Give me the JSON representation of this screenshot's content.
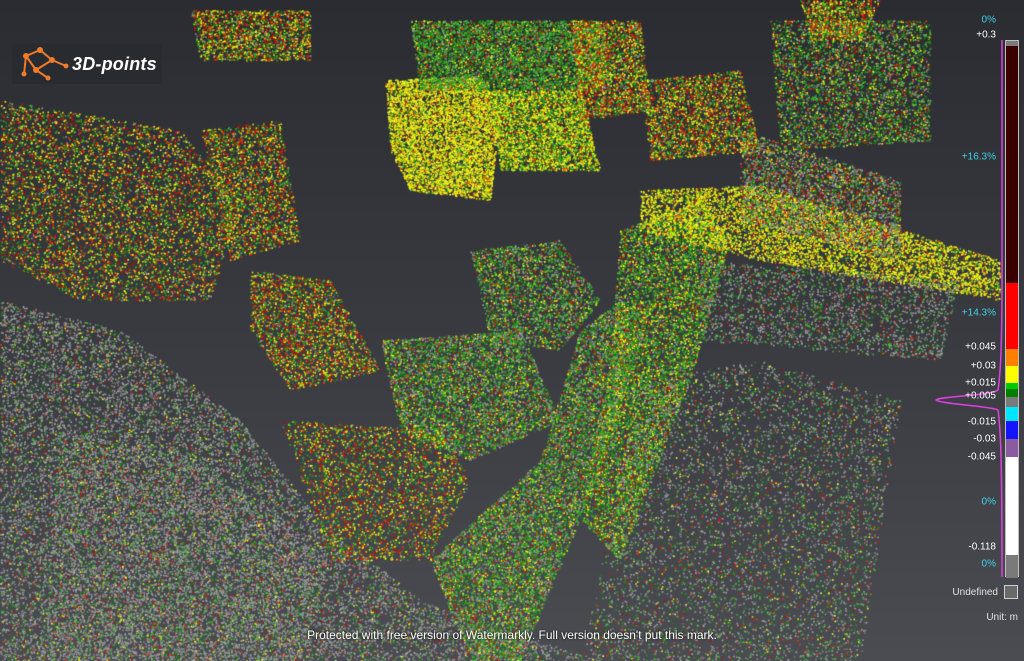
{
  "app": {
    "logo_text": "3D-points",
    "watermark": "Protected with free version of Watermarkly. Full version doesn't put this mark."
  },
  "scale": {
    "labels": {
      "pct_top": "0%",
      "max": "+0.3",
      "pct_mid1": "+16.3%",
      "pct_mid2": "+14.3%",
      "v045": "+0.045",
      "v03": "+0.03",
      "v015": "+0.015",
      "v005": "+0.005",
      "n015": "-0.015",
      "n03": "-0.03",
      "n045": "-0.045",
      "pct_low": "0%",
      "min": "-0.118",
      "pct_bottom": "0%"
    },
    "undefined_label": "Undefined",
    "unit": "Unit: m",
    "colors": {
      "dark_red": "#3a0000",
      "red": "#ff0000",
      "orange": "#ff7f00",
      "yellow": "#ffff00",
      "green": "#00c800",
      "dark_green": "#007f00",
      "cyan": "#00e5ff",
      "blue": "#1414ff",
      "purple": "#8c5aa0",
      "white": "#ffffff",
      "gray": "#7a7a7a",
      "histogram": "#e040e0"
    }
  }
}
